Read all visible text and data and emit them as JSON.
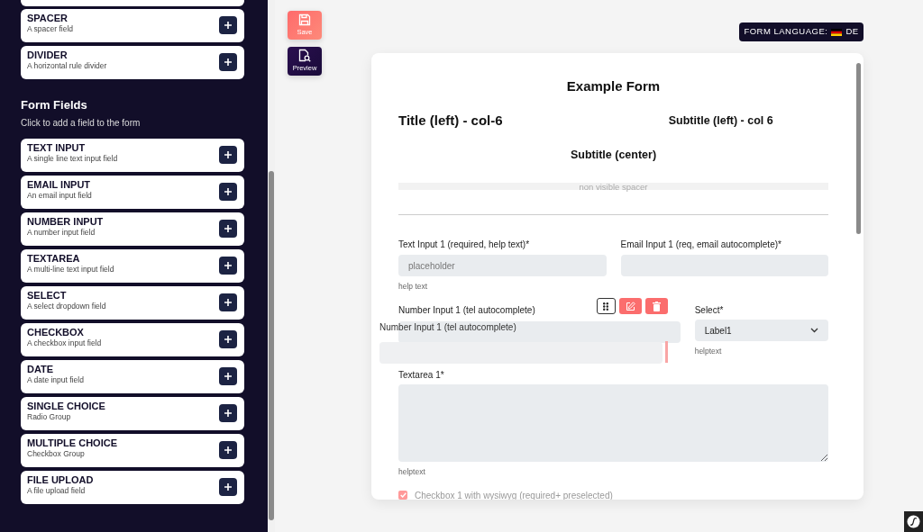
{
  "sidebar": {
    "layout_elements": [
      {
        "title": "SPACER",
        "description": "A spacer field"
      },
      {
        "title": "DIVIDER",
        "description": "A horizontal rule divider"
      }
    ],
    "section": {
      "title": "Form Fields",
      "subtitle": "Click to add a field to the form"
    },
    "field_types": [
      {
        "title": "TEXT INPUT",
        "description": "A single line text input field"
      },
      {
        "title": "EMAIL INPUT",
        "description": "An email input field"
      },
      {
        "title": "NUMBER INPUT",
        "description": "A number input field"
      },
      {
        "title": "TEXTAREA",
        "description": "A multi-line text input field"
      },
      {
        "title": "SELECT",
        "description": "A select dropdown field"
      },
      {
        "title": "CHECKBOX",
        "description": "A checkbox input field"
      },
      {
        "title": "DATE",
        "description": "A date input field"
      },
      {
        "title": "SINGLE CHOICE",
        "description": "Radio Group"
      },
      {
        "title": "MULTIPLE CHOICE",
        "description": "Checkbox Group"
      },
      {
        "title": "FILE UPLOAD",
        "description": "A file upload field"
      }
    ]
  },
  "actions": [
    {
      "kind": "save",
      "label": "Save"
    },
    {
      "kind": "preview",
      "label": "Preview"
    }
  ],
  "language": {
    "label": "FORM LANGUAGE:",
    "code": "DE"
  },
  "form": {
    "title": "Example Form",
    "heading_left": "Title (left) - col-6",
    "heading_right": "Subtitle (left) - col 6",
    "subtitle_center": "Subtitle (center)",
    "spacer_label": "non visible spacer",
    "rows": [
      [
        {
          "kind": "text",
          "label": "Text Input 1 (required, help text)*",
          "placeholder": "placeholder",
          "help": "help text"
        },
        {
          "kind": "email",
          "label": "Email Input 1 (req, email autocomplete)*"
        }
      ],
      [
        {
          "kind": "number",
          "label": "Number Input 1 (tel autocomplete)",
          "dragging": true,
          "ghost_label": "Number Input 1 (tel autocomplete)"
        },
        {
          "kind": "select",
          "label": "Select*",
          "value": "Label1",
          "help": "helptext"
        }
      ],
      [
        {
          "kind": "textarea",
          "label": "Textarea 1*",
          "help": "helptext"
        }
      ],
      [
        {
          "kind": "checkbox",
          "label": "Checkbox 1 with wysiwyg (required+ preselected)",
          "checked": true
        }
      ]
    ]
  }
}
